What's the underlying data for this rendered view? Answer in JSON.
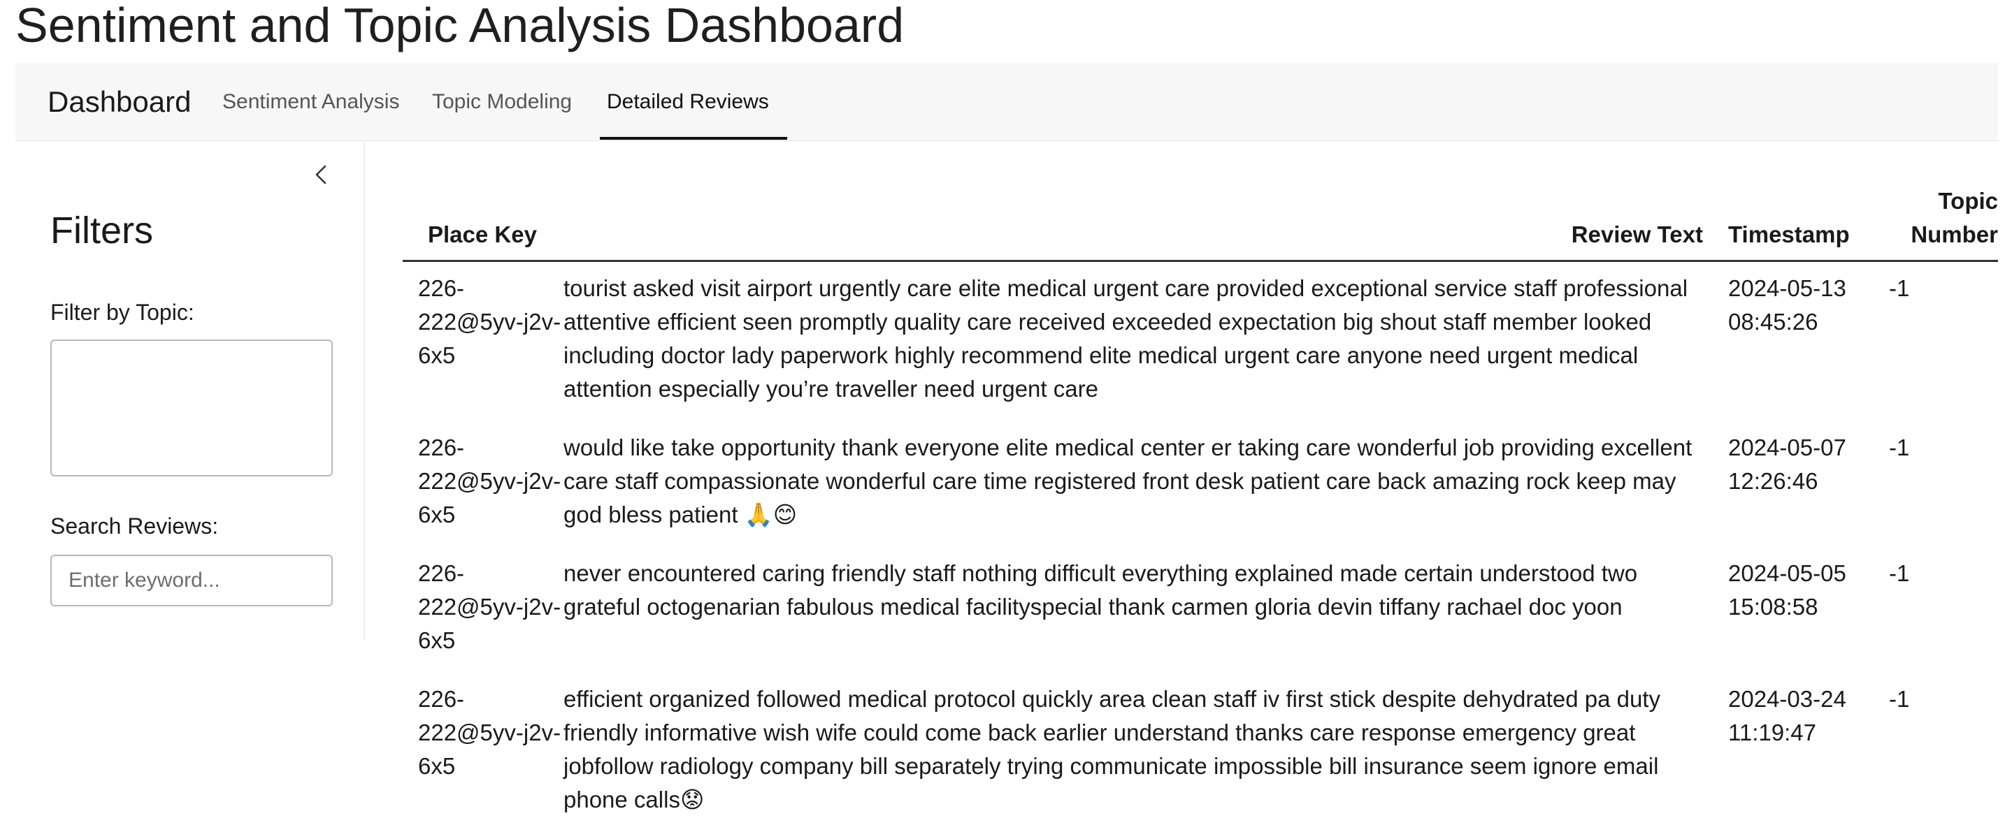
{
  "app": {
    "title": "Sentiment and Topic Analysis Dashboard"
  },
  "nav": {
    "brand": "Dashboard",
    "tabs": [
      {
        "label": "Sentiment Analysis",
        "active": false
      },
      {
        "label": "Topic Modeling",
        "active": false
      },
      {
        "label": "Detailed Reviews",
        "active": true
      }
    ]
  },
  "sidebar": {
    "collapse_icon": "chevron-left-icon",
    "heading": "Filters",
    "topic_filter": {
      "label": "Filter by Topic:",
      "value": ""
    },
    "search": {
      "label": "Search Reviews:",
      "placeholder": "Enter keyword...",
      "value": ""
    }
  },
  "table": {
    "columns": [
      "Place Key",
      "Review Text",
      "Timestamp",
      "Topic Number"
    ],
    "rows": [
      {
        "place_key": "226-222@5yv-j2v-6x5",
        "text": "tourist asked visit airport urgently care elite medical urgent care provided exceptional service staff professional attentive efficient seen promptly quality care received exceeded expectation big shout staff member looked including doctor lady paperwork highly recommend elite medical urgent care anyone need urgent medical attention especially you’re traveller need urgent care",
        "timestamp": "2024-05-13 08:45:26",
        "topic": "-1"
      },
      {
        "place_key": "226-222@5yv-j2v-6x5",
        "text": "would like take opportunity thank everyone elite medical center er taking care wonderful job providing excellent care staff compassionate wonderful care time registered front desk patient care back amazing rock keep may god bless patient 🙏😊",
        "timestamp": "2024-05-07 12:26:46",
        "topic": "-1"
      },
      {
        "place_key": "226-222@5yv-j2v-6x5",
        "text": "never encountered caring friendly staff nothing difficult everything explained made certain understood two grateful octogenarian fabulous medical facilityspecial thank carmen gloria devin tiffany rachael doc yoon",
        "timestamp": "2024-05-05 15:08:58",
        "topic": "-1"
      },
      {
        "place_key": "226-222@5yv-j2v-6x5",
        "text": "efficient organized followed medical protocol quickly area clean staff iv first stick despite dehydrated pa duty friendly informative wish wife could come back earlier understand thanks care response emergency great jobfollow radiology company bill separately trying communicate impossible bill insurance seem ignore email phone calls😟",
        "timestamp": "2024-03-24 11:19:47",
        "topic": "-1"
      }
    ]
  }
}
